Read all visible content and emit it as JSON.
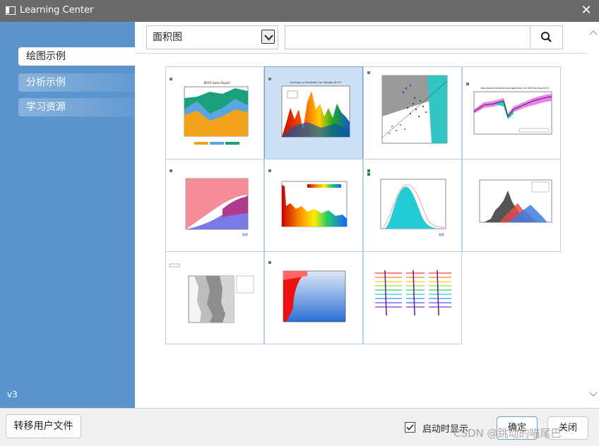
{
  "window": {
    "title": "Learning Center"
  },
  "sidebar": {
    "items": [
      {
        "label": "绘图示例",
        "active": true
      },
      {
        "label": "分析示例",
        "active": false
      },
      {
        "label": "学习资源",
        "active": false
      }
    ],
    "version": "v3"
  },
  "toolbar": {
    "category_selected": "面积图",
    "search_value": ""
  },
  "gallery": {
    "selected_index": 1,
    "thumbnails": [
      {
        "title": "BR10 Sales Report"
      },
      {
        "title": "Emission vs Excitation for Sample AY172"
      },
      {
        "title": ""
      },
      {
        "title": "Dow Jones Industrial average from Oct 2009 to Aug 2012"
      },
      {
        "title": ""
      },
      {
        "title": ""
      },
      {
        "title": ""
      },
      {
        "title": ""
      },
      {
        "title": ""
      },
      {
        "title": ""
      },
      {
        "title": ""
      }
    ]
  },
  "bottom": {
    "transfer_label": "转移用户文件",
    "startup_label": "启动时显示",
    "startup_checked": true,
    "ok_label": "确定",
    "close_label": "关闭",
    "watermark": "CSDN @跳动的喵尾巴"
  },
  "colors": {
    "titlebar": "#6b6a6a",
    "sidebar": "#5b95cf",
    "selected": "#cde0f6"
  }
}
